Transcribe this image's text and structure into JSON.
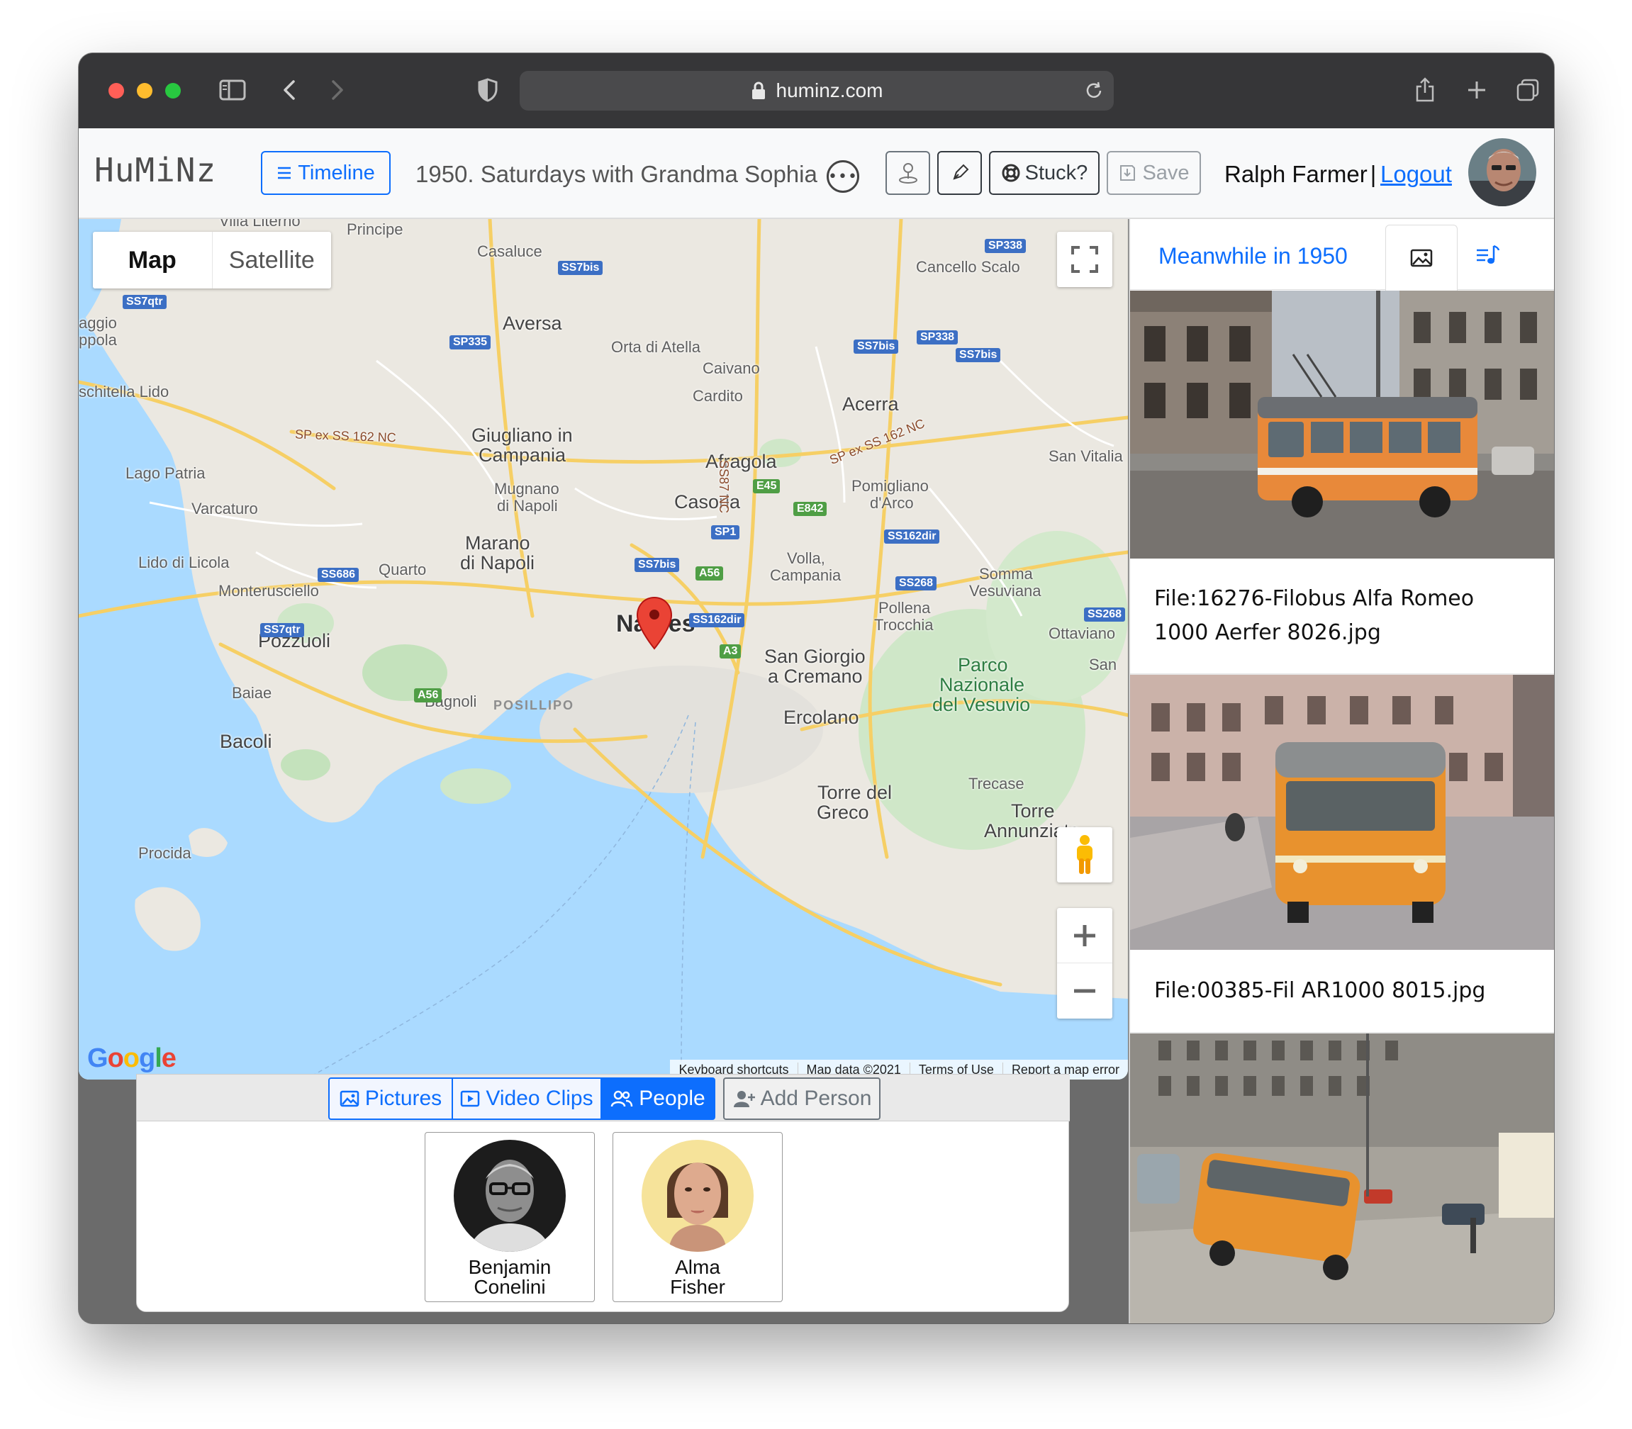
{
  "browser": {
    "url": "huminz.com"
  },
  "header": {
    "logo": "HuMiNz",
    "timeline_label": "Timeline",
    "story_title": "1950. Saturdays with Grandma Sophia",
    "stuck_label": "Stuck?",
    "save_label": "Save",
    "user_name": "Ralph Farmer",
    "separator": "|",
    "logout_label": "Logout"
  },
  "map": {
    "type_map": "Map",
    "type_satellite": "Satellite",
    "google": "Google",
    "attribution": [
      "Keyboard shortcuts",
      "Map data ©2021",
      "Terms of Use",
      "Report a map error"
    ],
    "labels": {
      "villa_literno": "Villa Literno",
      "principe": "Principe",
      "casaluce": "Casaluce",
      "cancello_scalo": "Cancello Scalo",
      "aggio": "aggio",
      "ppola": "ppola",
      "aversa": "Aversa",
      "orta": "Orta di Atella",
      "caivano": "Caivano",
      "cardito": "Cardito",
      "acerra": "Acerra",
      "schitella": "schitella Lido",
      "giugliano1": "Giugliano in",
      "giugliano2": "Campania",
      "afragola": "Afragola",
      "san_vitalia": "San Vitalia",
      "lago_patria": "Lago Patria",
      "mugnano1": "Mugnano",
      "mugnano2": "di Napoli",
      "pomigliano1": "Pomigliano",
      "pomigliano2": "d'Arco",
      "varcaturo": "Varcaturo",
      "casoria": "Casoria",
      "marano1": "Marano",
      "marano2": "di Napoli",
      "lido_licola": "Lido di Licola",
      "quarto": "Quarto",
      "volla1": "Volla,",
      "volla2": "Campania",
      "somma1": "Somma",
      "somma2": "Vesuviana",
      "monterusciello": "Monterusciello",
      "pollena1": "Pollena",
      "pollena2": "Trocchia",
      "naples": "Naples",
      "ottaviano": "Ottaviano",
      "pozzuoli": "Pozzuoli",
      "san_giorgio1": "San Giorgio",
      "san_giorgio2": "a Cremano",
      "parco1": "Parco",
      "parco2": "Nazionale",
      "parco3": "del Vesuvio",
      "san": "San",
      "baiae": "Baiae",
      "bagnoli": "Bagnoli",
      "posillipo": "POSILLIPO",
      "ercolano": "Ercolano",
      "bacoli": "Bacoli",
      "torre_greco1": "Torre del",
      "torre_greco2": "Greco",
      "trecase": "Trecase",
      "procida": "Procida",
      "torre_ann1": "Torre",
      "torre_ann2": "Annunziata",
      "sp_ex_1": "SP ex SS 162 NC",
      "sp_ex_2": "SP ex SS 162 NC",
      "ss87": "SS87 NC"
    },
    "shields": {
      "ss7qtr_1": "SS7qtr",
      "ss7bis_1": "SS7bis",
      "sp338_1": "SP338",
      "sp335": "SP335",
      "ss7bis_2": "SS7bis",
      "sp338_2": "SP338",
      "ss7bis_3": "SS7bis",
      "e45": "E45",
      "e842": "E842",
      "sp1": "SP1",
      "ss162dir_1": "SS162dir",
      "ss686": "SS686",
      "ss7bis_4": "SS7bis",
      "a56_1": "A56",
      "ss268_1": "SS268",
      "ss268_2": "SS268",
      "ss7qtr_2": "SS7qtr",
      "ss162dir_2": "SS162dir",
      "a3": "A3",
      "a56_2": "A56"
    }
  },
  "media_tabs": {
    "pictures": "Pictures",
    "video_clips": "Video Clips",
    "people": "People",
    "add_person": "Add Person"
  },
  "people": [
    {
      "first": "Benjamin",
      "last": "Conelini"
    },
    {
      "first": "Alma",
      "last": "Fisher"
    }
  ],
  "right_panel": {
    "meanwhile_label": "Meanwhile in 1950",
    "photos": [
      {
        "caption": "File:16276-Filobus Alfa Romeo 1000 Aerfer 8026.jpg"
      },
      {
        "caption": "File:00385-Fil AR1000 8015.jpg"
      }
    ]
  },
  "colors": {
    "accent": "#0d6efd",
    "toolbar": "#363638",
    "bus_orange": "#e8893a",
    "water": "#aadaff"
  }
}
